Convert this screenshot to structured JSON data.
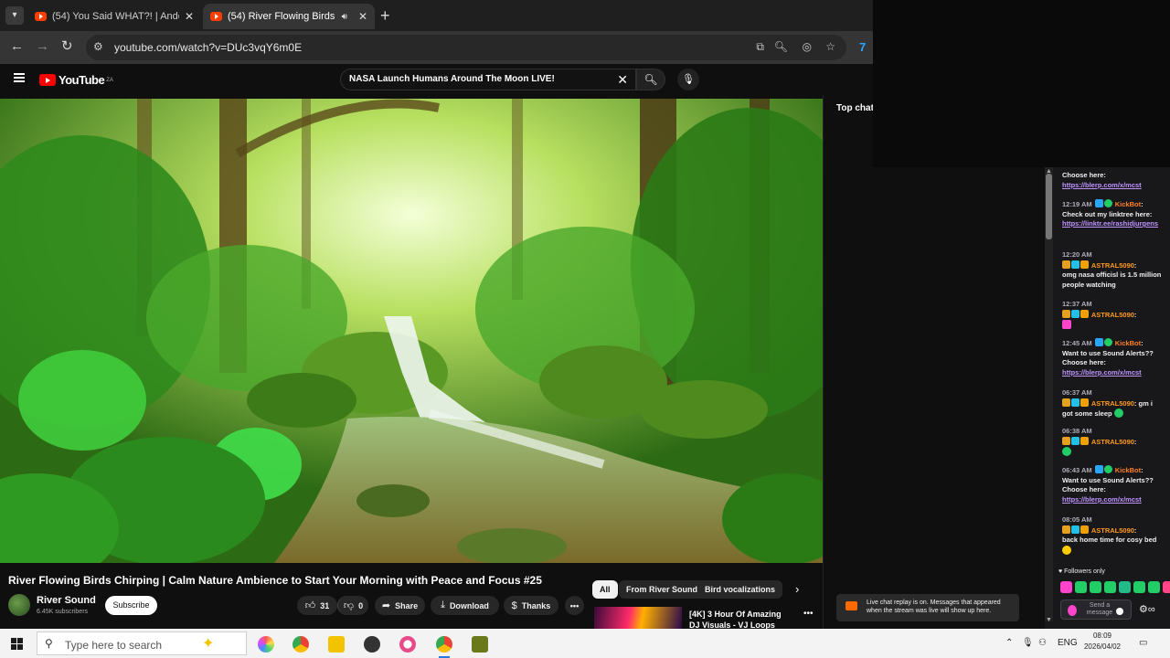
{
  "browser": {
    "tabs": [
      {
        "title": "(54) You Said WHAT?! | Anderso",
        "active": false
      },
      {
        "title": "(54) River Flowing Birds Chi",
        "active": true
      }
    ],
    "url": "youtube.com/watch?v=DUc3vqY6m0E"
  },
  "youtube": {
    "logo_text": "YouTube",
    "logo_region": "ZA",
    "search_value": "NASA Launch Humans Around The Moon LIVE!",
    "video_title": "River Flowing Birds Chirping | Calm Nature Ambience to Start Your Morning with Peace and Focus #25",
    "channel_name": "River Sound",
    "channel_subs": "6.45K subscribers",
    "subscribe_label": "Subscribe",
    "like_count": "31",
    "dislike_count": "0",
    "share_label": "Share",
    "download_label": "Download",
    "thanks_label": "Thanks",
    "chips": [
      "All",
      "From River Sound",
      "Bird vocalizations"
    ],
    "recommended": {
      "title": "[4K] 3 Hour Of Amazing DJ Visuals - VJ Loops"
    },
    "chat_header": "Top chat",
    "chat_replay_notice": "Live chat replay is on. Messages that appeared when the stream was live will show up here."
  },
  "stream_chat": {
    "messages": [
      {
        "time": "",
        "user": "",
        "text": "Choose here:",
        "link": "https://blerp.com/x/mcst"
      },
      {
        "time": "12:19 AM",
        "user": "KickBot",
        "user_type": "bot",
        "text": "Check out my linktree here:",
        "link": "https://linktr.ee/rashidjurgens"
      },
      {
        "time": "12:20 AM",
        "user": "ASTRAL5090",
        "user_type": "astral",
        "text": "omg nasa officisl is 1.5 million people watching",
        "link": ""
      },
      {
        "time": "12:37 AM",
        "user": "ASTRAL5090",
        "user_type": "astral",
        "text": "",
        "link": ""
      },
      {
        "time": "12:45 AM",
        "user": "KickBot",
        "user_type": "bot",
        "text": "Want to use Sound Alerts?? Choose here:",
        "link": "https://blerp.com/x/mcst"
      },
      {
        "time": "06:37 AM",
        "user": "ASTRAL5090",
        "user_type": "astral",
        "text": "gm i got some sleep",
        "link": ""
      },
      {
        "time": "06:38 AM",
        "user": "ASTRAL5090",
        "user_type": "astral",
        "text": "",
        "link": ""
      },
      {
        "time": "06:43 AM",
        "user": "KickBot",
        "user_type": "bot",
        "text": "Want to use Sound Alerts?? Choose here:",
        "link": "https://blerp.com/x/mcst"
      },
      {
        "time": "08:05 AM",
        "user": "ASTRAL5090",
        "user_type": "astral",
        "text": "back home time for cosy bed",
        "link": ""
      }
    ],
    "followers_only": "Followers only",
    "send_placeholder": "Send a message"
  },
  "taskbar": {
    "search_placeholder": "Type here to search",
    "language": "ENG",
    "time": "08:09",
    "date": "2026/04/02"
  },
  "colors": {
    "youtube_red": "#ff0000",
    "bot_name": "#ff7f24",
    "astral_name": "#ff9a1f",
    "chat_link": "#bf94ff"
  }
}
